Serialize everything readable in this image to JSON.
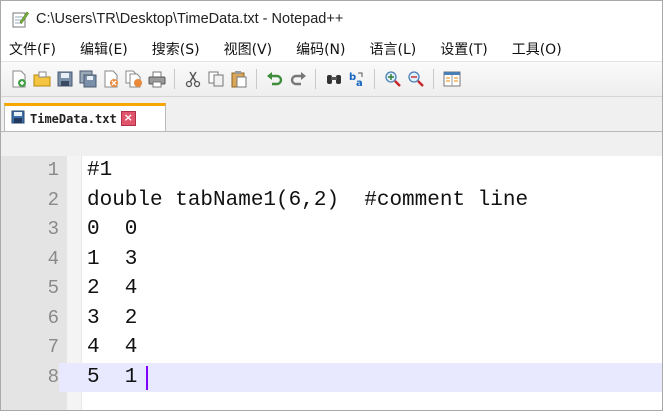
{
  "window": {
    "title": "C:\\Users\\TR\\Desktop\\TimeData.txt - Notepad++"
  },
  "menu": [
    {
      "label": "文件(F)"
    },
    {
      "label": "编辑(E)"
    },
    {
      "label": "搜索(S)"
    },
    {
      "label": "视图(V)"
    },
    {
      "label": "编码(N)"
    },
    {
      "label": "语言(L)"
    },
    {
      "label": "设置(T)"
    },
    {
      "label": "工具(O)"
    }
  ],
  "toolbar": {
    "icons": [
      "new-file-icon",
      "open-file-icon",
      "save-icon",
      "save-all-icon",
      "close-icon",
      "close-all-icon",
      "print-icon",
      "cut-icon",
      "copy-icon",
      "paste-icon",
      "undo-icon",
      "redo-icon",
      "find-icon",
      "replace-icon",
      "zoom-in-icon",
      "zoom-out-icon",
      "sync-view-icon"
    ]
  },
  "tab": {
    "label": "TimeData.txt",
    "close_glyph": "×"
  },
  "editor": {
    "lines": [
      {
        "num": "1",
        "text": "#1"
      },
      {
        "num": "2",
        "text": "double tabName1(6,2)  #comment line"
      },
      {
        "num": "3",
        "text": "0  0"
      },
      {
        "num": "4",
        "text": "1  3"
      },
      {
        "num": "5",
        "text": "2  4"
      },
      {
        "num": "6",
        "text": "3  2"
      },
      {
        "num": "7",
        "text": "4  4"
      },
      {
        "num": "8",
        "text": "5  1"
      }
    ],
    "current_line": 8,
    "colors": {
      "current_line_bg": "#e8e8ff",
      "caret": "#8000ff",
      "tab_accent": "#f7a700"
    }
  }
}
